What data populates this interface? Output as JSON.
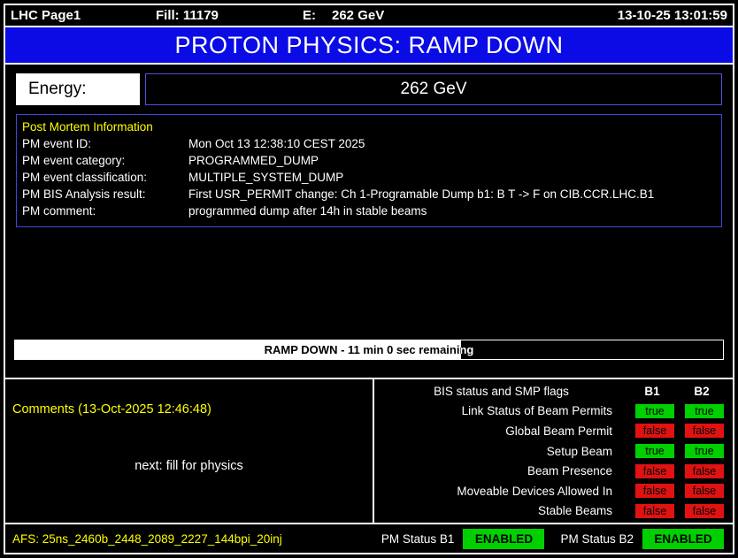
{
  "header": {
    "page_title": "LHC Page1",
    "fill": "Fill: 11179",
    "energy_label": "E:",
    "energy_value": "262 GeV",
    "datetime": "13-10-25 13:01:59"
  },
  "banner": {
    "title": "PROTON PHYSICS: RAMP DOWN"
  },
  "energy": {
    "label": "Energy:",
    "value": "262 GeV"
  },
  "post_mortem": {
    "title": "Post Mortem Information",
    "rows": [
      {
        "label": "PM event ID:",
        "value": "Mon Oct 13 12:38:10 CEST 2025"
      },
      {
        "label": "PM event category:",
        "value": "PROGRAMMED_DUMP"
      },
      {
        "label": "PM event classification:",
        "value": "MULTIPLE_SYSTEM_DUMP"
      },
      {
        "label": "PM BIS Analysis result:",
        "value": "First USR_PERMIT change: Ch 1-Programable Dump b1: B T -> F on CIB.CCR.LHC.B1"
      },
      {
        "label": "PM comment:",
        "value": "programmed dump after 14h in stable beams"
      }
    ]
  },
  "progress": {
    "text": "RAMP DOWN - 11 min 0 sec remaining",
    "percent": 63
  },
  "comments": {
    "title": "Comments (13-Oct-2025 12:46:48)",
    "body": "next: fill for physics"
  },
  "bis": {
    "title": "BIS status and SMP flags",
    "col_b1": "B1",
    "col_b2": "B2",
    "rows": [
      {
        "label": "Link Status of Beam Permits",
        "b1": "true",
        "b2": "true"
      },
      {
        "label": "Global Beam Permit",
        "b1": "false",
        "b2": "false"
      },
      {
        "label": "Setup Beam",
        "b1": "true",
        "b2": "true"
      },
      {
        "label": "Beam Presence",
        "b1": "false",
        "b2": "false"
      },
      {
        "label": "Moveable Devices Allowed In",
        "b1": "false",
        "b2": "false"
      },
      {
        "label": "Stable Beams",
        "b1": "false",
        "b2": "false"
      }
    ]
  },
  "footer": {
    "afs": "AFS: 25ns_2460b_2448_2089_2227_144bpi_20inj",
    "pm_b1_label": "PM Status B1",
    "pm_b1_value": "ENABLED",
    "pm_b2_label": "PM Status B2",
    "pm_b2_value": "ENABLED"
  },
  "colors": {
    "banner_blue": "#0b0be6",
    "accent_yellow": "#ffff00",
    "flag_true": "#00d000",
    "flag_false": "#e01212",
    "enabled": "#00d000"
  }
}
